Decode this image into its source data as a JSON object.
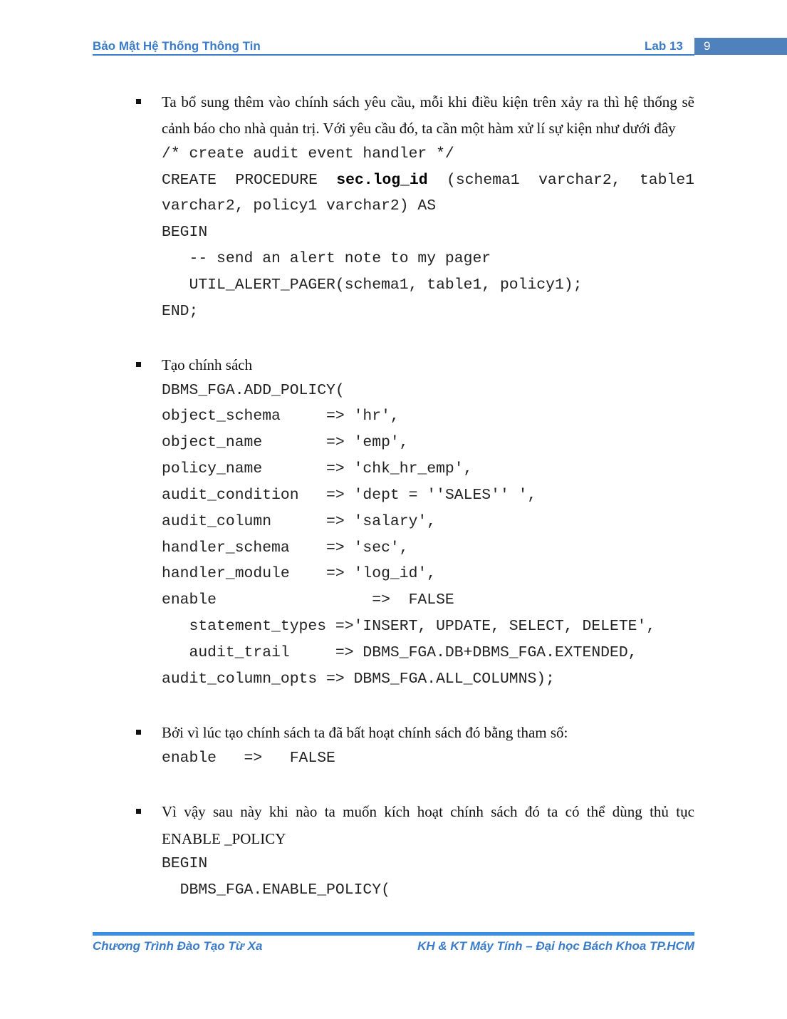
{
  "header": {
    "title": "Bảo Mật Hệ Thống Thông Tin",
    "lab": "Lab 13",
    "page": "9"
  },
  "footer": {
    "left": "Chương Trình Đào Tạo Từ Xa",
    "right": "KH & KT Máy Tính – Đại học Bách Khoa TP.HCM"
  },
  "body": {
    "p1": [
      "Ta bổ sung thêm vào chính sách yêu cầu, mỗi khi điều kiện trên xảy ra thì hệ thống sẽ",
      "cảnh báo cho nhà quản trị. Với yêu cầu đó, ta cần một hàm xử lí sự kiện như dưới đây"
    ],
    "code1": {
      "comment": "/* create audit event handler */",
      "create_parts": [
        "CREATE",
        "PROCEDURE",
        "sec.log_id",
        "(schema1",
        "varchar2,",
        "table1"
      ],
      "lines": [
        "varchar2, policy1 varchar2) AS",
        "BEGIN",
        "   -- send an alert note to my pager",
        "   UTIL_ALERT_PAGER(schema1, table1, policy1);",
        "END;"
      ]
    },
    "p2": "Tạo chính sách",
    "code2": [
      "DBMS_FGA.ADD_POLICY(",
      "object_schema     => 'hr',",
      "object_name       => 'emp',",
      "policy_name       => 'chk_hr_emp',",
      "audit_condition   => 'dept = ''SALES'' ',",
      "audit_column      => 'salary',",
      "handler_schema    => 'sec',",
      "handler_module    => 'log_id',",
      "enable                 =>  FALSE",
      "   statement_types =>'INSERT, UPDATE, SELECT, DELETE',",
      "   audit_trail     => DBMS_FGA.DB+DBMS_FGA.EXTENDED,",
      "audit_column_opts => DBMS_FGA.ALL_COLUMNS);"
    ],
    "p3": "Bởi vì lúc tạo chính sách ta đã bất hoạt chính sách đó bằng tham số:",
    "code3": "enable   =>   FALSE",
    "p4": [
      "Vì vậy sau này khi nào ta muốn kích hoạt chính sách đó ta có thể dùng thủ tục",
      "ENABLE _POLICY"
    ],
    "code4": [
      "BEGIN",
      "  DBMS_FGA.ENABLE_POLICY("
    ]
  }
}
